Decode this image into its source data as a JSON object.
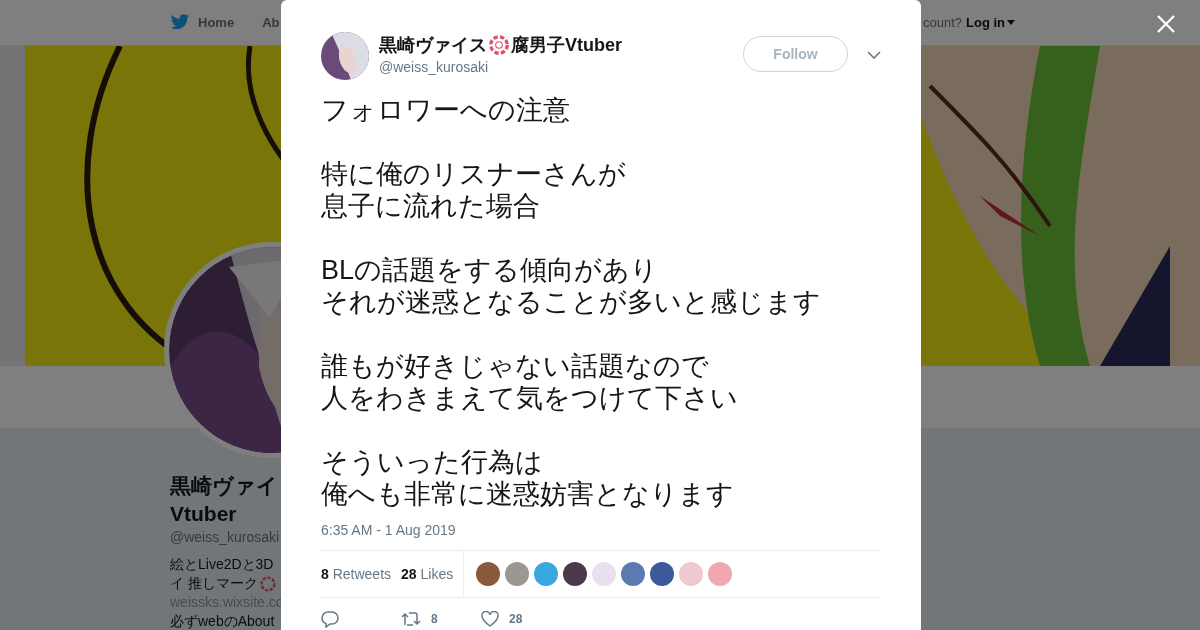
{
  "background_page": {
    "nav": {
      "home": "Home",
      "about": "Ab",
      "login_prompt": "count?",
      "login": "Log in"
    },
    "profile": {
      "name_line1": "黒崎ヴァイ",
      "name_line2": "Vtuber",
      "handle": "@weiss_kurosaki",
      "bio_lines": [
        "絵とLive2Dと3D",
        "イ 推しマーク"
      ],
      "link": "weissks.wixsite.co",
      "bio_more": "必ずwebのAbout"
    }
  },
  "tweet": {
    "author": {
      "name_before_icon": "黒崎ヴァイス",
      "name_after_icon": "腐男子Vtuber",
      "handle": "@weiss_kurosaki"
    },
    "follow_button": "Follow",
    "paragraphs": [
      [
        "フォロワーへの注意"
      ],
      [
        "特に俺のリスナーさんが",
        "息子に流れた場合"
      ],
      [
        "BLの話題をする傾向があり",
        "それが迷惑となることが多いと感じます"
      ],
      [
        "誰もが好きじゃない話題なので",
        "人をわきまえて気をつけて下さい"
      ],
      [
        "そういった行為は",
        "俺へも非常に迷惑妨害となります"
      ]
    ],
    "timestamp": "6:35 AM - 1 Aug 2019",
    "stats": [
      {
        "count": "8",
        "label": "Retweets"
      },
      {
        "count": "28",
        "label": "Likes"
      }
    ],
    "likers": [
      {
        "color": "#8a5a3a"
      },
      {
        "color": "#9a9890"
      },
      {
        "color": "#3aa8e0"
      },
      {
        "color": "#4a3a4a"
      },
      {
        "color": "#e8e0ec"
      },
      {
        "color": "#5a7ab0"
      },
      {
        "color": "#3a5a9a"
      },
      {
        "color": "#f0c8d0"
      },
      {
        "color": "#f0a8b0"
      }
    ],
    "actions": [
      {
        "kind": "reply"
      },
      {
        "kind": "retweet",
        "count": "8"
      },
      {
        "kind": "like",
        "count": "28"
      }
    ]
  }
}
